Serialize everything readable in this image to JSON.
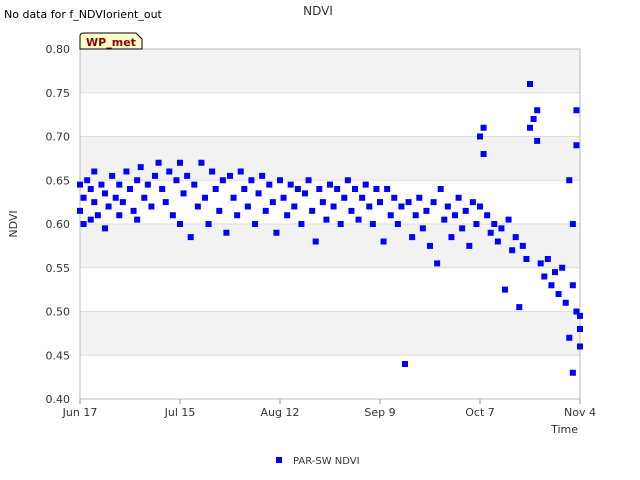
{
  "note": "No data for f_NDVIorient_out",
  "badge": "WP_met",
  "colors": {
    "series": "#0000ff",
    "band": "#f2f2f2",
    "grid": "#dddddd",
    "badge_bg": "#ffffcc",
    "badge_text": "#8b0000"
  },
  "chart_data": {
    "type": "scatter",
    "title": "NDVI",
    "xlabel": "Time",
    "ylabel": "NDVI",
    "ylim": [
      0.4,
      0.8
    ],
    "xlim": [
      "2024-06-17",
      "2024-11-04"
    ],
    "yticks": [
      "0.40",
      "0.45",
      "0.50",
      "0.55",
      "0.60",
      "0.65",
      "0.70",
      "0.75",
      "0.80"
    ],
    "xticks": [
      {
        "date": "2024-06-17",
        "label": "Jun 17"
      },
      {
        "date": "2024-07-15",
        "label": "Jul 15"
      },
      {
        "date": "2024-08-12",
        "label": "Aug 12"
      },
      {
        "date": "2024-09-09",
        "label": "Sep 9"
      },
      {
        "date": "2024-10-07",
        "label": "Oct 7"
      },
      {
        "date": "2024-11-04",
        "label": "Nov 4"
      }
    ],
    "legend_position": "bottom",
    "series": [
      {
        "name": "PAR-SW NDVI",
        "points": [
          [
            "2024-06-17",
            0.645
          ],
          [
            "2024-06-17",
            0.615
          ],
          [
            "2024-06-18",
            0.6
          ],
          [
            "2024-06-18",
            0.63
          ],
          [
            "2024-06-19",
            0.65
          ],
          [
            "2024-06-20",
            0.64
          ],
          [
            "2024-06-20",
            0.605
          ],
          [
            "2024-06-21",
            0.66
          ],
          [
            "2024-06-21",
            0.625
          ],
          [
            "2024-06-22",
            0.61
          ],
          [
            "2024-06-23",
            0.645
          ],
          [
            "2024-06-24",
            0.635
          ],
          [
            "2024-06-24",
            0.595
          ],
          [
            "2024-06-25",
            0.62
          ],
          [
            "2024-06-26",
            0.655
          ],
          [
            "2024-06-27",
            0.63
          ],
          [
            "2024-06-28",
            0.61
          ],
          [
            "2024-06-28",
            0.645
          ],
          [
            "2024-06-29",
            0.625
          ],
          [
            "2024-06-30",
            0.66
          ],
          [
            "2024-07-01",
            0.64
          ],
          [
            "2024-07-02",
            0.615
          ],
          [
            "2024-07-03",
            0.65
          ],
          [
            "2024-07-03",
            0.605
          ],
          [
            "2024-07-04",
            0.665
          ],
          [
            "2024-07-05",
            0.63
          ],
          [
            "2024-07-06",
            0.645
          ],
          [
            "2024-07-07",
            0.62
          ],
          [
            "2024-07-08",
            0.655
          ],
          [
            "2024-07-09",
            0.67
          ],
          [
            "2024-07-10",
            0.64
          ],
          [
            "2024-07-11",
            0.625
          ],
          [
            "2024-07-12",
            0.66
          ],
          [
            "2024-07-13",
            0.61
          ],
          [
            "2024-07-14",
            0.65
          ],
          [
            "2024-07-15",
            0.67
          ],
          [
            "2024-07-15",
            0.6
          ],
          [
            "2024-07-16",
            0.635
          ],
          [
            "2024-07-17",
            0.655
          ],
          [
            "2024-07-18",
            0.585
          ],
          [
            "2024-07-19",
            0.645
          ],
          [
            "2024-07-20",
            0.62
          ],
          [
            "2024-07-21",
            0.67
          ],
          [
            "2024-07-22",
            0.63
          ],
          [
            "2024-07-23",
            0.6
          ],
          [
            "2024-07-24",
            0.66
          ],
          [
            "2024-07-25",
            0.64
          ],
          [
            "2024-07-26",
            0.615
          ],
          [
            "2024-07-27",
            0.65
          ],
          [
            "2024-07-28",
            0.59
          ],
          [
            "2024-07-29",
            0.655
          ],
          [
            "2024-07-30",
            0.63
          ],
          [
            "2024-07-31",
            0.61
          ],
          [
            "2024-08-01",
            0.66
          ],
          [
            "2024-08-02",
            0.64
          ],
          [
            "2024-08-03",
            0.62
          ],
          [
            "2024-08-04",
            0.65
          ],
          [
            "2024-08-05",
            0.6
          ],
          [
            "2024-08-06",
            0.635
          ],
          [
            "2024-08-07",
            0.655
          ],
          [
            "2024-08-08",
            0.615
          ],
          [
            "2024-08-09",
            0.645
          ],
          [
            "2024-08-10",
            0.625
          ],
          [
            "2024-08-11",
            0.59
          ],
          [
            "2024-08-12",
            0.65
          ],
          [
            "2024-08-13",
            0.63
          ],
          [
            "2024-08-14",
            0.61
          ],
          [
            "2024-08-15",
            0.645
          ],
          [
            "2024-08-16",
            0.62
          ],
          [
            "2024-08-17",
            0.64
          ],
          [
            "2024-08-18",
            0.6
          ],
          [
            "2024-08-19",
            0.635
          ],
          [
            "2024-08-20",
            0.65
          ],
          [
            "2024-08-21",
            0.615
          ],
          [
            "2024-08-22",
            0.58
          ],
          [
            "2024-08-23",
            0.64
          ],
          [
            "2024-08-24",
            0.625
          ],
          [
            "2024-08-25",
            0.605
          ],
          [
            "2024-08-26",
            0.645
          ],
          [
            "2024-08-27",
            0.62
          ],
          [
            "2024-08-28",
            0.64
          ],
          [
            "2024-08-29",
            0.6
          ],
          [
            "2024-08-30",
            0.63
          ],
          [
            "2024-08-31",
            0.65
          ],
          [
            "2024-09-01",
            0.615
          ],
          [
            "2024-09-02",
            0.64
          ],
          [
            "2024-09-03",
            0.605
          ],
          [
            "2024-09-04",
            0.63
          ],
          [
            "2024-09-05",
            0.645
          ],
          [
            "2024-09-06",
            0.62
          ],
          [
            "2024-09-07",
            0.6
          ],
          [
            "2024-09-08",
            0.64
          ],
          [
            "2024-09-09",
            0.625
          ],
          [
            "2024-09-10",
            0.58
          ],
          [
            "2024-09-11",
            0.64
          ],
          [
            "2024-09-12",
            0.61
          ],
          [
            "2024-09-13",
            0.63
          ],
          [
            "2024-09-14",
            0.6
          ],
          [
            "2024-09-15",
            0.62
          ],
          [
            "2024-09-16",
            0.44
          ],
          [
            "2024-09-17",
            0.625
          ],
          [
            "2024-09-18",
            0.585
          ],
          [
            "2024-09-19",
            0.61
          ],
          [
            "2024-09-20",
            0.63
          ],
          [
            "2024-09-21",
            0.595
          ],
          [
            "2024-09-22",
            0.615
          ],
          [
            "2024-09-23",
            0.575
          ],
          [
            "2024-09-24",
            0.625
          ],
          [
            "2024-09-25",
            0.555
          ],
          [
            "2024-09-26",
            0.64
          ],
          [
            "2024-09-27",
            0.605
          ],
          [
            "2024-09-28",
            0.62
          ],
          [
            "2024-09-29",
            0.585
          ],
          [
            "2024-09-30",
            0.61
          ],
          [
            "2024-10-01",
            0.63
          ],
          [
            "2024-10-02",
            0.595
          ],
          [
            "2024-10-03",
            0.615
          ],
          [
            "2024-10-04",
            0.575
          ],
          [
            "2024-10-05",
            0.625
          ],
          [
            "2024-10-06",
            0.6
          ],
          [
            "2024-10-07",
            0.62
          ],
          [
            "2024-10-07",
            0.7
          ],
          [
            "2024-10-08",
            0.71
          ],
          [
            "2024-10-08",
            0.68
          ],
          [
            "2024-10-09",
            0.61
          ],
          [
            "2024-10-10",
            0.59
          ],
          [
            "2024-10-11",
            0.6
          ],
          [
            "2024-10-12",
            0.58
          ],
          [
            "2024-10-13",
            0.595
          ],
          [
            "2024-10-14",
            0.525
          ],
          [
            "2024-10-15",
            0.605
          ],
          [
            "2024-10-16",
            0.57
          ],
          [
            "2024-10-17",
            0.585
          ],
          [
            "2024-10-18",
            0.505
          ],
          [
            "2024-10-19",
            0.575
          ],
          [
            "2024-10-20",
            0.56
          ],
          [
            "2024-10-21",
            0.76
          ],
          [
            "2024-10-21",
            0.71
          ],
          [
            "2024-10-22",
            0.72
          ],
          [
            "2024-10-23",
            0.73
          ],
          [
            "2024-10-23",
            0.695
          ],
          [
            "2024-10-24",
            0.555
          ],
          [
            "2024-10-25",
            0.54
          ],
          [
            "2024-10-26",
            0.56
          ],
          [
            "2024-10-27",
            0.53
          ],
          [
            "2024-10-28",
            0.545
          ],
          [
            "2024-10-29",
            0.52
          ],
          [
            "2024-10-30",
            0.55
          ],
          [
            "2024-10-31",
            0.51
          ],
          [
            "2024-11-01",
            0.65
          ],
          [
            "2024-11-01",
            0.47
          ],
          [
            "2024-11-02",
            0.6
          ],
          [
            "2024-11-02",
            0.53
          ],
          [
            "2024-11-03",
            0.5
          ],
          [
            "2024-11-03",
            0.73
          ],
          [
            "2024-11-03",
            0.69
          ],
          [
            "2024-11-04",
            0.48
          ],
          [
            "2024-11-04",
            0.46
          ],
          [
            "2024-11-04",
            0.495
          ],
          [
            "2024-11-02",
            0.43
          ]
        ]
      }
    ]
  }
}
